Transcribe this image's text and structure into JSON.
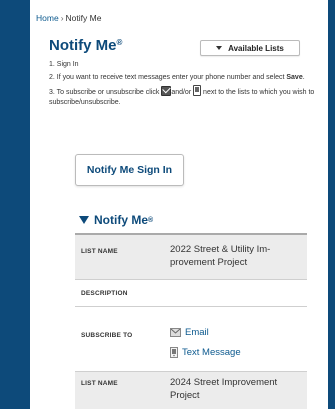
{
  "breadcrumb": {
    "home": "Home",
    "separator": "›",
    "current": "Notify Me"
  },
  "page": {
    "title": "Notify Me",
    "title_mark": "®",
    "available_lists_label": "Available Lists"
  },
  "steps": {
    "step1": "1. Sign In",
    "step2_pre": "2. If you want to receive text messages enter your phone number and select ",
    "step2_bold": "Save",
    "step2_post": ".",
    "step3_pre": "3. To subscribe or unsubscribe click ",
    "step3_mid": "and/or ",
    "step3_post": " next to the lists to which you wish to subscribe/unsubscribe."
  },
  "signin_label": "Notify Me Sign In",
  "section": {
    "title": "Notify Me",
    "mark": "®"
  },
  "table": {
    "list_name_label": "LIST NAME",
    "description_label": "DESCRIPTION",
    "subscribe_label": "SUBSCRIBE TO",
    "row1_value_line1": "2022 Street & Utility Im-",
    "row1_value_line2": "provement Project",
    "email_label": "Email",
    "text_label": "Text Message",
    "row2_value_line1": "2024 Street Improvement",
    "row2_value_line2": "Project"
  },
  "colors": {
    "frame": "#0d4a7a",
    "link": "#0d5a8f",
    "accent": "#0d4a7a"
  }
}
